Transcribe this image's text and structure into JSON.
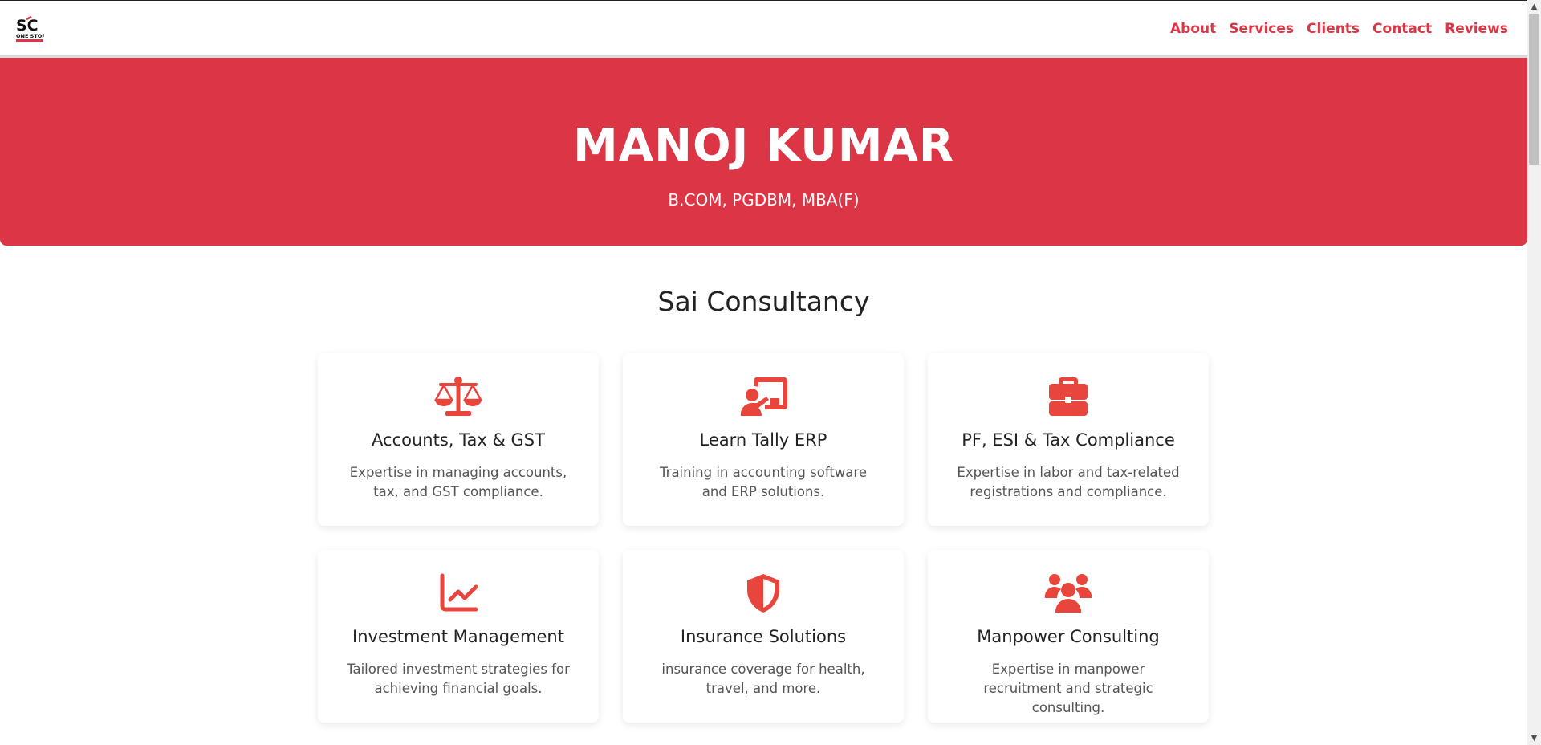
{
  "brand": {
    "logo_text": "SC",
    "logo_subtext": "ONE STOP"
  },
  "nav": {
    "items": [
      {
        "label": "About"
      },
      {
        "label": "Services"
      },
      {
        "label": "Clients"
      },
      {
        "label": "Contact"
      },
      {
        "label": "Reviews"
      }
    ]
  },
  "hero": {
    "name": "MANOJ KUMAR",
    "qualifications": "B.COM, PGDBM, MBA(F)"
  },
  "services": {
    "title": "Sai Consultancy",
    "cards": [
      {
        "icon": "scale-balance-icon",
        "title": "Accounts, Tax & GST",
        "description": "Expertise in managing accounts, tax, and GST compliance."
      },
      {
        "icon": "chalkboard-teacher-icon",
        "title": "Learn Tally ERP",
        "description": "Training in accounting software and ERP solutions."
      },
      {
        "icon": "briefcase-icon",
        "title": "PF, ESI & Tax Compliance",
        "description": "Expertise in labor and tax-related registrations and compliance."
      },
      {
        "icon": "chart-line-icon",
        "title": "Investment Management",
        "description": "Tailored investment strategies for achieving financial goals."
      },
      {
        "icon": "shield-icon",
        "title": "Insurance Solutions",
        "description": "insurance coverage for health, travel, and more."
      },
      {
        "icon": "users-icon",
        "title": "Manpower Consulting",
        "description": "Expertise in manpower recruitment and strategic consulting."
      }
    ]
  },
  "colors": {
    "accent": "#dc3545",
    "icon": "#e8453c"
  }
}
